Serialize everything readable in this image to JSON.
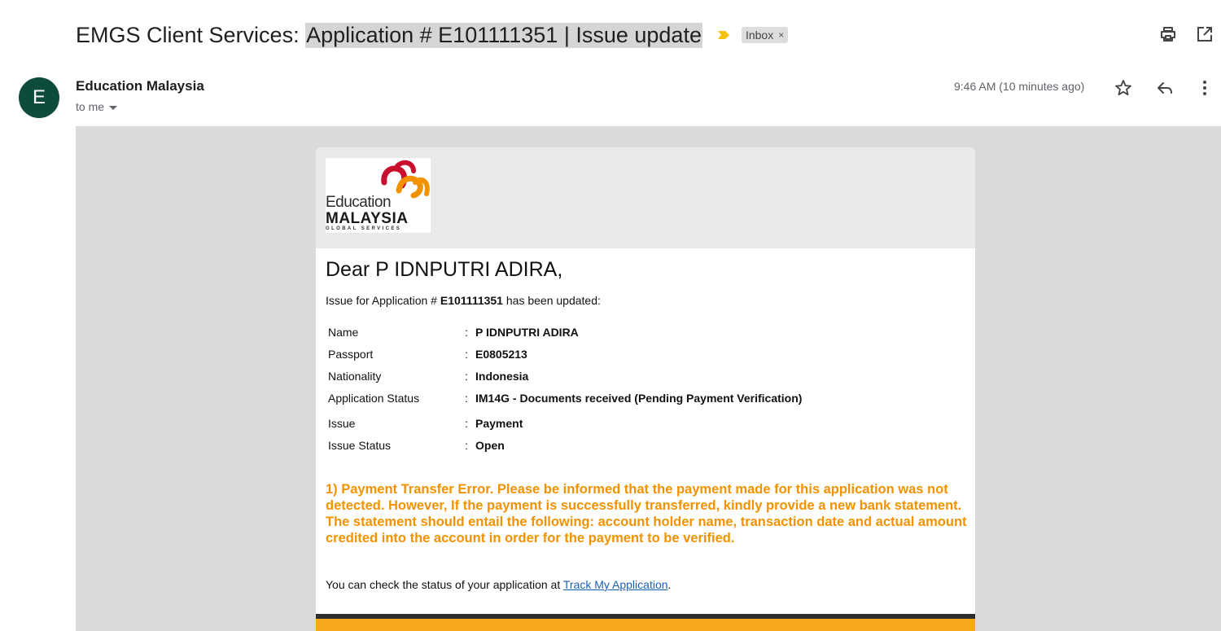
{
  "subject": {
    "prefix": "EMGS Client Services: ",
    "highlighted": "Application # E101111351 | Issue update",
    "label_chip": "Inbox",
    "label_remove": "×"
  },
  "toolbar": {
    "print_icon": "print-icon",
    "popout_icon": "open-in-new-window-icon"
  },
  "sender": {
    "avatar_letter": "E",
    "avatar_color": "#0d4c3c",
    "name": "Education Malaysia",
    "to": "to me",
    "time": "9:46 AM (10 minutes ago)"
  },
  "email": {
    "logo": {
      "word1": "Education",
      "word2": "MALAYSIA",
      "word3": "GLOBAL SERVICES"
    },
    "greeting": "Dear P IDNPUTRI ADIRA,",
    "intro_before": "Issue for Application # ",
    "intro_app_no": "E101111351",
    "intro_after": " has been updated:",
    "separator": ":",
    "details": [
      {
        "label": "Name",
        "value": "P IDNPUTRI ADIRA"
      },
      {
        "label": "Passport",
        "value": "E0805213"
      },
      {
        "label": "Nationality",
        "value": "Indonesia"
      },
      {
        "label": "Application Status",
        "value": "IM14G - Documents received (Pending Payment Verification)"
      },
      {
        "label": "Issue",
        "value": "Payment"
      },
      {
        "label": "Issue Status",
        "value": "Open"
      }
    ],
    "notice": "1) Payment Transfer Error. Please be informed that the payment made for this application was not detected. However, If the payment is successfully transferred, kindly provide a new bank statement. The statement should entail the following: account holder name, transaction date and actual amount credited into the account in order for the payment to be verified.",
    "status_before": "You can check the status of your application at ",
    "status_link": "Track My Application",
    "status_after": "."
  },
  "colors": {
    "notice": "#f39200",
    "footer_bar": "#f6a81c",
    "link": "#1a5fb4"
  }
}
